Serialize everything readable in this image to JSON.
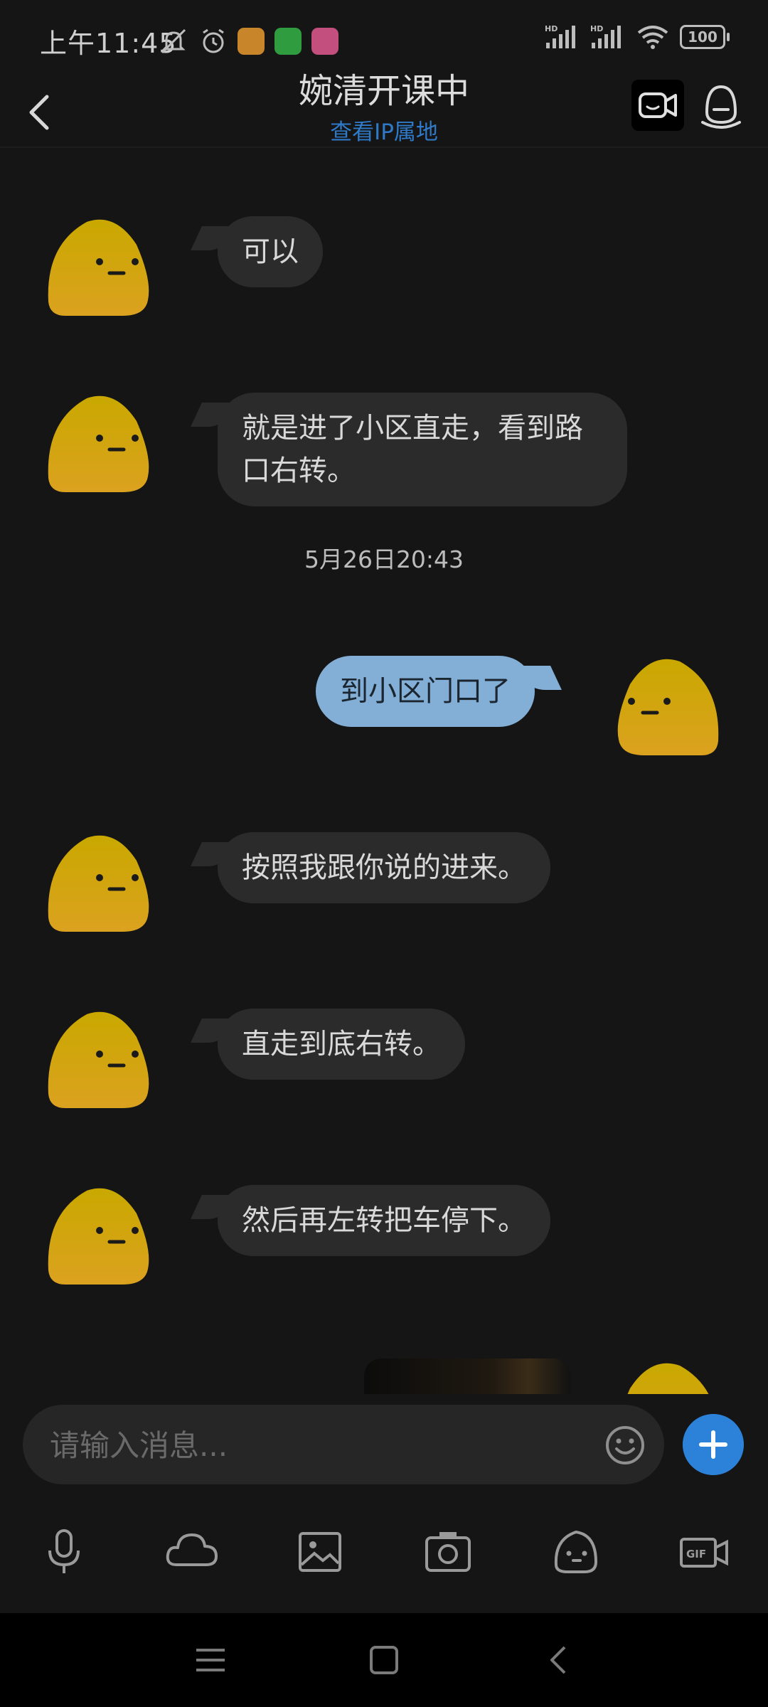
{
  "status_bar": {
    "time": "上午11:45",
    "battery": "100",
    "network": "HD"
  },
  "header": {
    "title": "婉清开课中",
    "subtitle": "查看IP属地"
  },
  "messages": [
    {
      "from": "other",
      "text": "可以"
    },
    {
      "from": "other",
      "text": "就是进了小区直走，看到路口右转。"
    },
    {
      "timestamp": "5月26日20:43"
    },
    {
      "from": "me",
      "text": "到小区门口了"
    },
    {
      "from": "other",
      "text": "按照我跟你说的进来。"
    },
    {
      "from": "other",
      "text": "直走到底右转。"
    },
    {
      "from": "other",
      "text": "然后再左转把车停下。"
    },
    {
      "from": "me",
      "type": "image"
    }
  ],
  "input": {
    "placeholder": "请输入消息..."
  },
  "toolbar": [
    "microphone-icon",
    "cloud-icon",
    "image-icon",
    "camera-icon",
    "emoji-face-icon",
    "gif-icon"
  ],
  "colors": {
    "background": "#151515",
    "bubble_in": "#2b2b2b",
    "bubble_out": "#83aed5",
    "accent": "#2b82d8",
    "avatar": "#d9ae12"
  }
}
